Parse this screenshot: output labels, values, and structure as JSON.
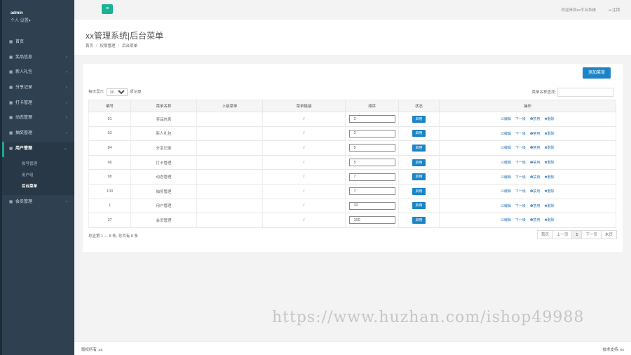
{
  "sidebar": {
    "username": "admin",
    "user_menu": "个人 设置▾",
    "items": [
      {
        "icon": "grid-icon",
        "label": "首页",
        "has_children": false
      },
      {
        "icon": "grid-icon",
        "label": "奖品信息",
        "has_children": true
      },
      {
        "icon": "grid-icon",
        "label": "新人礼包",
        "has_children": true
      },
      {
        "icon": "grid-icon",
        "label": "分享记录",
        "has_children": true
      },
      {
        "icon": "grid-icon",
        "label": "打卡管理",
        "has_children": true
      },
      {
        "icon": "grid-icon",
        "label": "动态管理",
        "has_children": true
      },
      {
        "icon": "grid-icon",
        "label": "抽奖管理",
        "has_children": true
      },
      {
        "icon": "grid-icon",
        "label": "用户管理",
        "has_children": true,
        "active": true
      },
      {
        "icon": "grid-icon",
        "label": "会员管理",
        "has_children": true
      }
    ],
    "sub_items": [
      "账号管理",
      "用户组",
      "后台菜单"
    ]
  },
  "topbar": {
    "menu_icon": "≡",
    "welcome": "欢迎来到xx平台系统",
    "logout": "注销"
  },
  "header": {
    "title": "xx管理系统|后台菜单",
    "breadcrumb": [
      "首页",
      "权限管理",
      "后台菜单"
    ]
  },
  "panel": {
    "add_button": "添加菜单",
    "length_prefix": "每页显示",
    "length_value": "10",
    "length_suffix": "项记录",
    "search_label": "菜单名称查找:",
    "columns": [
      "编号",
      "菜单名称",
      "上级菜单",
      "菜单链接",
      "排序",
      "状态",
      "操作"
    ],
    "rows": [
      {
        "id": "91",
        "name": "奖品信息",
        "parent": "",
        "link": "/",
        "sort": "2",
        "status": "启用"
      },
      {
        "id": "93",
        "name": "新人礼包",
        "parent": "",
        "link": "/",
        "sort": "2",
        "status": "启用"
      },
      {
        "id": "84",
        "name": "分享记录",
        "parent": "",
        "link": "/",
        "sort": "5",
        "status": "启用"
      },
      {
        "id": "96",
        "name": "打卡管理",
        "parent": "",
        "link": "/",
        "sort": "5",
        "status": "启用"
      },
      {
        "id": "98",
        "name": "动态管理",
        "parent": "",
        "link": "/",
        "sort": "7",
        "status": "启用"
      },
      {
        "id": "100",
        "name": "抽奖管理",
        "parent": "",
        "link": "/",
        "sort": "7",
        "status": "启用"
      },
      {
        "id": "1",
        "name": "用户管理",
        "parent": "",
        "link": "/",
        "sort": "10",
        "status": "启用"
      },
      {
        "id": "37",
        "name": "会员管理",
        "parent": "",
        "link": "/",
        "sort": "100",
        "status": "启用"
      }
    ],
    "actions": {
      "edit": "☑编辑",
      "next": "下一级",
      "disable": "❶禁用",
      "delete": "✖删除"
    },
    "info": "总显第 1 — 8 条, 总共有 8 条",
    "pager": [
      "首页",
      "上一页",
      "1",
      "下一页",
      "末页"
    ]
  },
  "footer": {
    "copyright": "版权所有 :xx",
    "support": "技术支持: xx"
  },
  "watermark": "https://www.huzhan.com/ishop49988",
  "colors": {
    "sidebar": "#2f4050",
    "accent_green": "#1ab394",
    "primary_blue": "#1c84c6"
  }
}
